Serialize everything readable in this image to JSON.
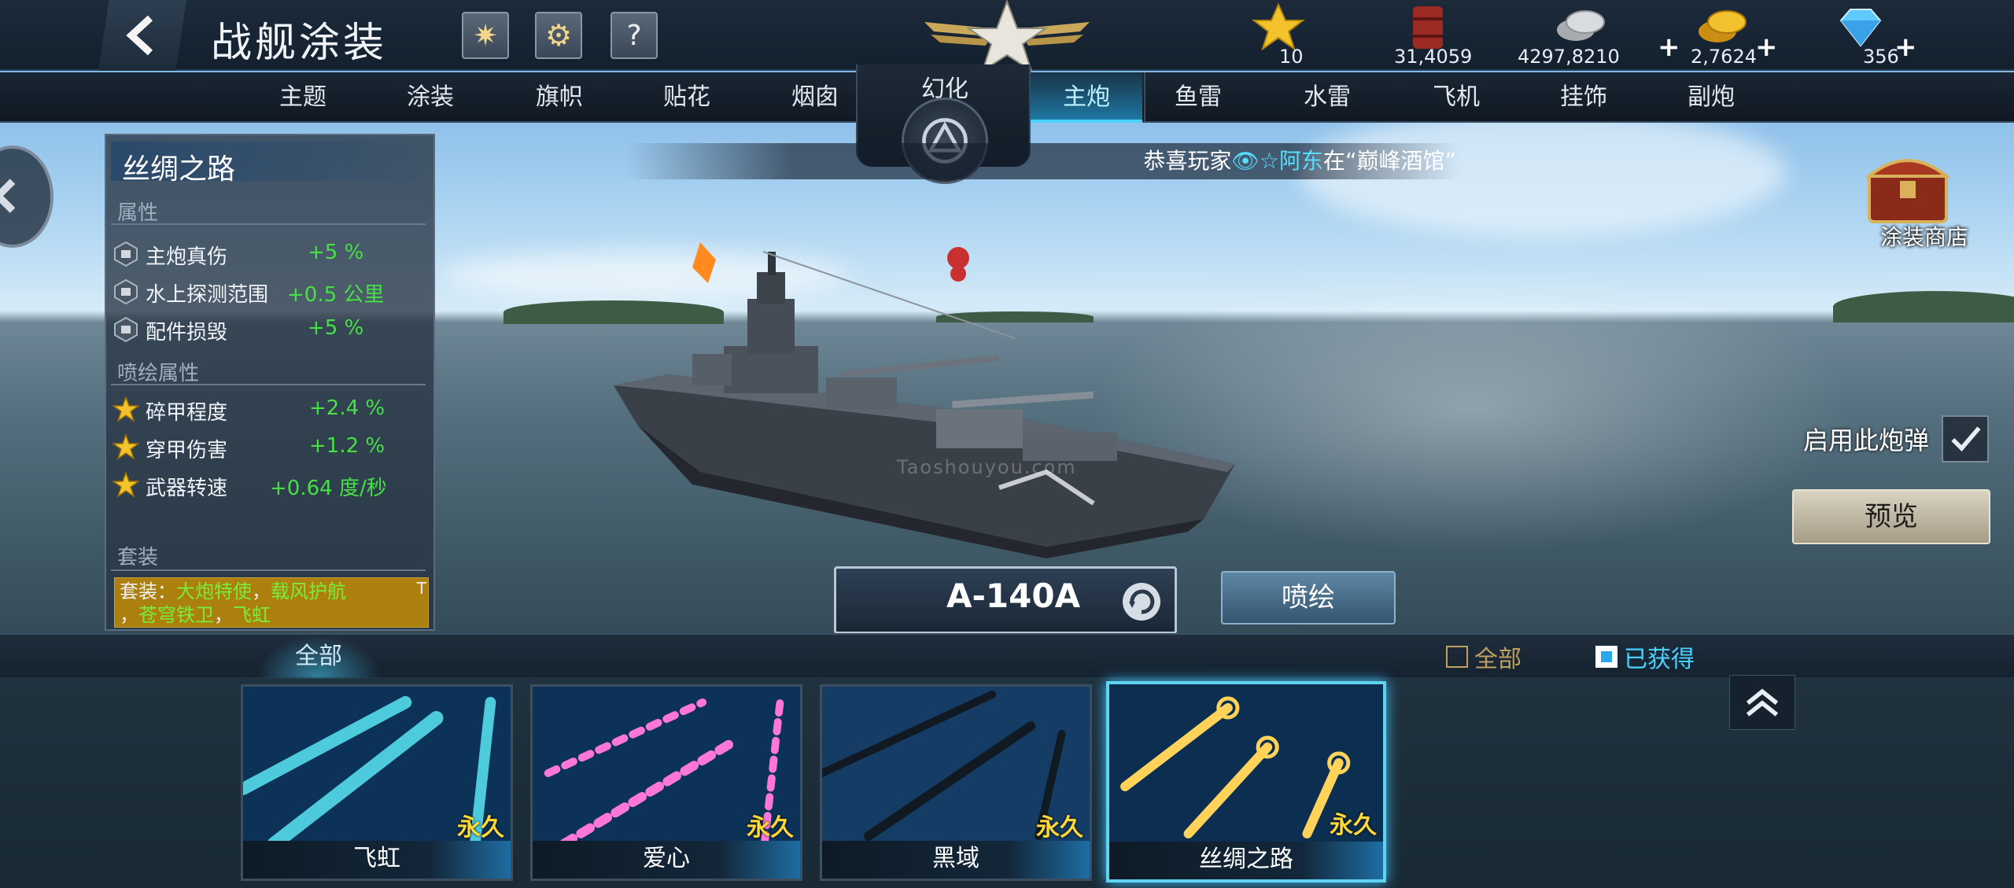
{
  "header": {
    "title": "战舰涂装",
    "icons": [
      "back-arrow-icon",
      "firework-icon",
      "gear-icon",
      "question-icon",
      "rank-star-emblem"
    ]
  },
  "currencies": [
    {
      "name": "star",
      "value": "10",
      "plus": ""
    },
    {
      "name": "oil-barrel",
      "value": "31,4059",
      "plus": ""
    },
    {
      "name": "silver-coins",
      "value": "4297,8210",
      "plus": "+"
    },
    {
      "name": "gold-coins",
      "value": "2,7624",
      "plus": "+"
    },
    {
      "name": "diamond",
      "value": "356",
      "plus": "+"
    }
  ],
  "tabs": [
    {
      "label": "主题"
    },
    {
      "label": "涂装"
    },
    {
      "label": "旗帜"
    },
    {
      "label": "贴花"
    },
    {
      "label": "烟囱"
    },
    {
      "label": "幻化"
    },
    {
      "label": "主炮",
      "active": true
    },
    {
      "label": "鱼雷"
    },
    {
      "label": "水雷"
    },
    {
      "label": "飞机"
    },
    {
      "label": "挂饰"
    },
    {
      "label": "副炮"
    }
  ],
  "ticker": {
    "prefix": "恭喜玩家",
    "player": "👁☆阿东",
    "suffix": "在“巅峰酒馆”"
  },
  "attributes": {
    "title": "丝绸之路",
    "section1_label": "属性",
    "rows1": [
      {
        "name": "主炮真伤",
        "value": "+5 %"
      },
      {
        "name": "水上探测范围",
        "value": "+0.5 公里"
      },
      {
        "name": "配件损毁",
        "value": "+5 %"
      }
    ],
    "section2_label": "喷绘属性",
    "rows2": [
      {
        "name": "碎甲程度",
        "value": "+2.4 %"
      },
      {
        "name": "穿甲伤害",
        "value": "+1.2 %"
      },
      {
        "name": "武器转速",
        "value": "+0.64 度/秒"
      }
    ],
    "section3_label": "套装",
    "set": {
      "prefix": "套装：",
      "items": [
        "大炮特使",
        "载风护航",
        "苍穹铁卫",
        "飞虹"
      ],
      "sep": "，",
      "tag": "T"
    }
  },
  "watermark": "Taoshouyou.com",
  "shop_label": "涂装商店",
  "enable_shell_label": "启用此炮弹",
  "enable_shell_checked": true,
  "preview_label": "预览",
  "shell_name": "A-140A",
  "paint_label": "喷绘",
  "filter": {
    "tab_all": "全部",
    "opt_all": "全部",
    "opt_owned": "已获得",
    "opt_owned_checked": true
  },
  "cards": [
    {
      "name": "飞虹",
      "tag": "永久",
      "color": "#5ff0ff"
    },
    {
      "name": "爱心",
      "tag": "永久",
      "color": "#ff77d6"
    },
    {
      "name": "黑域",
      "tag": "永久",
      "color": "#111a22"
    },
    {
      "name": "丝绸之路",
      "tag": "永久",
      "color": "#ffd25a",
      "selected": true
    }
  ],
  "colors": {
    "accent": "#4ad2ff",
    "positive": "#46e046",
    "gold": "#ffd836"
  }
}
